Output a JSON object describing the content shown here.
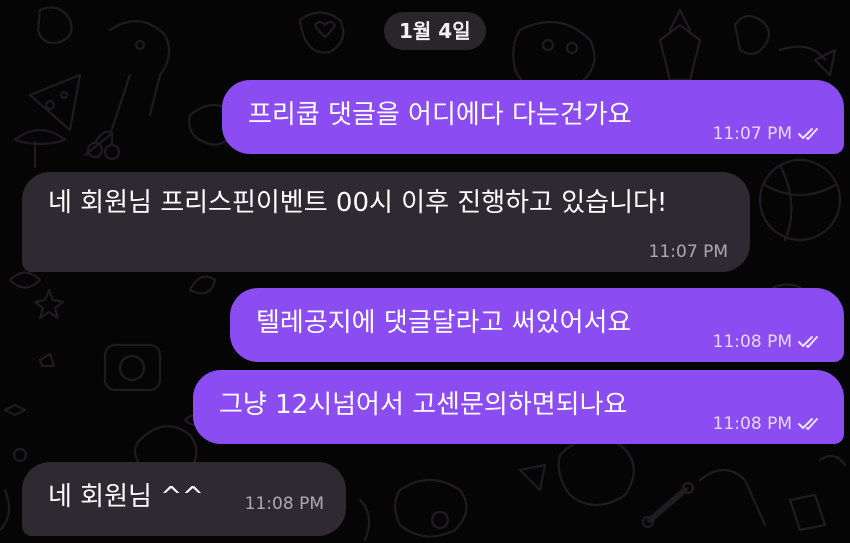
{
  "chat": {
    "date_separator": "1월 4일",
    "messages": [
      {
        "direction": "outgoing",
        "text": "프리쿱 댓글을 어디에다 다는건가요",
        "time": "11:07 PM",
        "status": "read"
      },
      {
        "direction": "incoming",
        "text": "네 회원님 프리스핀이벤트 00시 이후 진행하고 있습니다!",
        "time": "11:07 PM"
      },
      {
        "direction": "outgoing",
        "text": "텔레공지에 댓글달라고 써있어서요",
        "time": "11:08 PM",
        "status": "read"
      },
      {
        "direction": "outgoing",
        "text": "그냥 12시넘어서 고센문의하면되나요",
        "time": "11:08 PM",
        "status": "read"
      },
      {
        "direction": "incoming",
        "text": "네 회원님 ^^",
        "time": "11:08 PM"
      }
    ]
  },
  "colors": {
    "background": "#050506",
    "outgoing_bubble": "#8b4cf2",
    "incoming_bubble": "#2f2a31",
    "date_pill": "#2c282e",
    "doodle_stroke": "#1e1b21"
  },
  "icons": {
    "read_receipt": "double-check-icon"
  }
}
